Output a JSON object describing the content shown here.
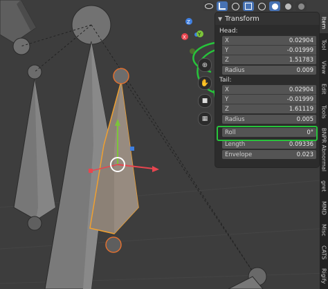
{
  "panel": {
    "title": "Transform",
    "head_label": "Head:",
    "head": {
      "x": {
        "label": "X",
        "value": "0.02904"
      },
      "y": {
        "label": "Y",
        "value": "-0.01999"
      },
      "z": {
        "label": "Z",
        "value": "1.51783"
      }
    },
    "head_radius": {
      "label": "Radius",
      "value": "0.009"
    },
    "tail_label": "Tail:",
    "tail": {
      "x": {
        "label": "X",
        "value": "0.02904"
      },
      "y": {
        "label": "Y",
        "value": "-0.01999"
      },
      "z": {
        "label": "Z",
        "value": "1.61119"
      }
    },
    "tail_radius": {
      "label": "Radius",
      "value": "0.005"
    },
    "roll": {
      "label": "Roll",
      "value": "0°"
    },
    "length": {
      "label": "Length",
      "value": "0.09336"
    },
    "envelope": {
      "label": "Envelope",
      "value": "0.023"
    }
  },
  "tabs": [
    "Item",
    "Tool",
    "View",
    "Edit",
    "Tools",
    "BNPR Abnormal",
    "gret",
    "MMD",
    "Misc",
    "CATS",
    "Rigify"
  ],
  "gizmo_axes": {
    "x": "X",
    "y": "Y",
    "z": "Z"
  },
  "colors": {
    "highlight": "#27c43b",
    "selected_bone": "#f0a030",
    "x_axis": "#e8454f",
    "y_axis": "#7cc43a",
    "z_axis": "#3f7fe0",
    "active": "#4772b3"
  }
}
